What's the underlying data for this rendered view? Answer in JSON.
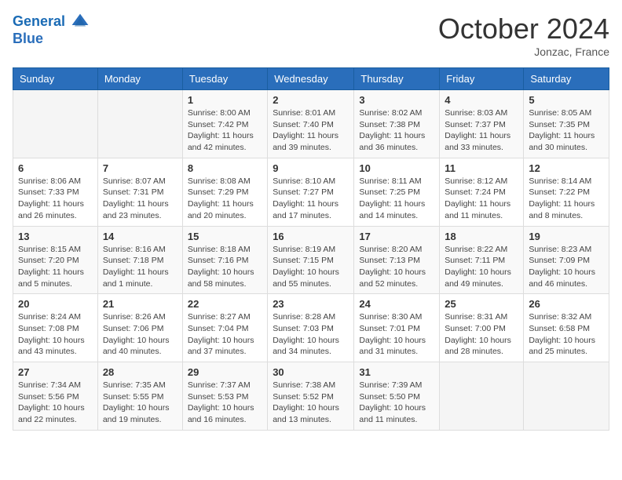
{
  "header": {
    "logo_line1": "General",
    "logo_line2": "Blue",
    "month": "October 2024",
    "location": "Jonzac, France"
  },
  "weekdays": [
    "Sunday",
    "Monday",
    "Tuesday",
    "Wednesday",
    "Thursday",
    "Friday",
    "Saturday"
  ],
  "weeks": [
    [
      {
        "day": "",
        "sunrise": "",
        "sunset": "",
        "daylight": ""
      },
      {
        "day": "",
        "sunrise": "",
        "sunset": "",
        "daylight": ""
      },
      {
        "day": "1",
        "sunrise": "Sunrise: 8:00 AM",
        "sunset": "Sunset: 7:42 PM",
        "daylight": "Daylight: 11 hours and 42 minutes."
      },
      {
        "day": "2",
        "sunrise": "Sunrise: 8:01 AM",
        "sunset": "Sunset: 7:40 PM",
        "daylight": "Daylight: 11 hours and 39 minutes."
      },
      {
        "day": "3",
        "sunrise": "Sunrise: 8:02 AM",
        "sunset": "Sunset: 7:38 PM",
        "daylight": "Daylight: 11 hours and 36 minutes."
      },
      {
        "day": "4",
        "sunrise": "Sunrise: 8:03 AM",
        "sunset": "Sunset: 7:37 PM",
        "daylight": "Daylight: 11 hours and 33 minutes."
      },
      {
        "day": "5",
        "sunrise": "Sunrise: 8:05 AM",
        "sunset": "Sunset: 7:35 PM",
        "daylight": "Daylight: 11 hours and 30 minutes."
      }
    ],
    [
      {
        "day": "6",
        "sunrise": "Sunrise: 8:06 AM",
        "sunset": "Sunset: 7:33 PM",
        "daylight": "Daylight: 11 hours and 26 minutes."
      },
      {
        "day": "7",
        "sunrise": "Sunrise: 8:07 AM",
        "sunset": "Sunset: 7:31 PM",
        "daylight": "Daylight: 11 hours and 23 minutes."
      },
      {
        "day": "8",
        "sunrise": "Sunrise: 8:08 AM",
        "sunset": "Sunset: 7:29 PM",
        "daylight": "Daylight: 11 hours and 20 minutes."
      },
      {
        "day": "9",
        "sunrise": "Sunrise: 8:10 AM",
        "sunset": "Sunset: 7:27 PM",
        "daylight": "Daylight: 11 hours and 17 minutes."
      },
      {
        "day": "10",
        "sunrise": "Sunrise: 8:11 AM",
        "sunset": "Sunset: 7:25 PM",
        "daylight": "Daylight: 11 hours and 14 minutes."
      },
      {
        "day": "11",
        "sunrise": "Sunrise: 8:12 AM",
        "sunset": "Sunset: 7:24 PM",
        "daylight": "Daylight: 11 hours and 11 minutes."
      },
      {
        "day": "12",
        "sunrise": "Sunrise: 8:14 AM",
        "sunset": "Sunset: 7:22 PM",
        "daylight": "Daylight: 11 hours and 8 minutes."
      }
    ],
    [
      {
        "day": "13",
        "sunrise": "Sunrise: 8:15 AM",
        "sunset": "Sunset: 7:20 PM",
        "daylight": "Daylight: 11 hours and 5 minutes."
      },
      {
        "day": "14",
        "sunrise": "Sunrise: 8:16 AM",
        "sunset": "Sunset: 7:18 PM",
        "daylight": "Daylight: 11 hours and 1 minute."
      },
      {
        "day": "15",
        "sunrise": "Sunrise: 8:18 AM",
        "sunset": "Sunset: 7:16 PM",
        "daylight": "Daylight: 10 hours and 58 minutes."
      },
      {
        "day": "16",
        "sunrise": "Sunrise: 8:19 AM",
        "sunset": "Sunset: 7:15 PM",
        "daylight": "Daylight: 10 hours and 55 minutes."
      },
      {
        "day": "17",
        "sunrise": "Sunrise: 8:20 AM",
        "sunset": "Sunset: 7:13 PM",
        "daylight": "Daylight: 10 hours and 52 minutes."
      },
      {
        "day": "18",
        "sunrise": "Sunrise: 8:22 AM",
        "sunset": "Sunset: 7:11 PM",
        "daylight": "Daylight: 10 hours and 49 minutes."
      },
      {
        "day": "19",
        "sunrise": "Sunrise: 8:23 AM",
        "sunset": "Sunset: 7:09 PM",
        "daylight": "Daylight: 10 hours and 46 minutes."
      }
    ],
    [
      {
        "day": "20",
        "sunrise": "Sunrise: 8:24 AM",
        "sunset": "Sunset: 7:08 PM",
        "daylight": "Daylight: 10 hours and 43 minutes."
      },
      {
        "day": "21",
        "sunrise": "Sunrise: 8:26 AM",
        "sunset": "Sunset: 7:06 PM",
        "daylight": "Daylight: 10 hours and 40 minutes."
      },
      {
        "day": "22",
        "sunrise": "Sunrise: 8:27 AM",
        "sunset": "Sunset: 7:04 PM",
        "daylight": "Daylight: 10 hours and 37 minutes."
      },
      {
        "day": "23",
        "sunrise": "Sunrise: 8:28 AM",
        "sunset": "Sunset: 7:03 PM",
        "daylight": "Daylight: 10 hours and 34 minutes."
      },
      {
        "day": "24",
        "sunrise": "Sunrise: 8:30 AM",
        "sunset": "Sunset: 7:01 PM",
        "daylight": "Daylight: 10 hours and 31 minutes."
      },
      {
        "day": "25",
        "sunrise": "Sunrise: 8:31 AM",
        "sunset": "Sunset: 7:00 PM",
        "daylight": "Daylight: 10 hours and 28 minutes."
      },
      {
        "day": "26",
        "sunrise": "Sunrise: 8:32 AM",
        "sunset": "Sunset: 6:58 PM",
        "daylight": "Daylight: 10 hours and 25 minutes."
      }
    ],
    [
      {
        "day": "27",
        "sunrise": "Sunrise: 7:34 AM",
        "sunset": "Sunset: 5:56 PM",
        "daylight": "Daylight: 10 hours and 22 minutes."
      },
      {
        "day": "28",
        "sunrise": "Sunrise: 7:35 AM",
        "sunset": "Sunset: 5:55 PM",
        "daylight": "Daylight: 10 hours and 19 minutes."
      },
      {
        "day": "29",
        "sunrise": "Sunrise: 7:37 AM",
        "sunset": "Sunset: 5:53 PM",
        "daylight": "Daylight: 10 hours and 16 minutes."
      },
      {
        "day": "30",
        "sunrise": "Sunrise: 7:38 AM",
        "sunset": "Sunset: 5:52 PM",
        "daylight": "Daylight: 10 hours and 13 minutes."
      },
      {
        "day": "31",
        "sunrise": "Sunrise: 7:39 AM",
        "sunset": "Sunset: 5:50 PM",
        "daylight": "Daylight: 10 hours and 11 minutes."
      },
      {
        "day": "",
        "sunrise": "",
        "sunset": "",
        "daylight": ""
      },
      {
        "day": "",
        "sunrise": "",
        "sunset": "",
        "daylight": ""
      }
    ]
  ]
}
